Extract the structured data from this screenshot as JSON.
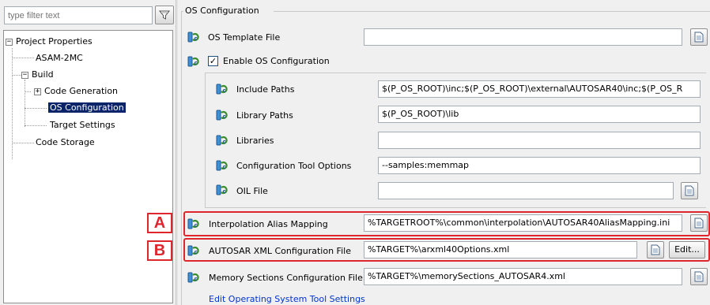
{
  "filter": {
    "placeholder": "type filter text"
  },
  "tree": {
    "root": "Project Properties",
    "items": {
      "asam": "ASAM-2MC",
      "build": "Build",
      "code_generation": "Code Generation",
      "os_configuration": "OS Configuration",
      "target_settings": "Target Settings",
      "code_storage": "Code Storage"
    },
    "selected": "OS Configuration"
  },
  "group": {
    "title": "OS Configuration"
  },
  "os_template": {
    "label": "OS Template File",
    "value": ""
  },
  "enable_os": {
    "label": "Enable OS Configuration",
    "checked": true
  },
  "include_paths": {
    "label": "Include Paths",
    "value": "$(P_OS_ROOT)\\inc;$(P_OS_ROOT)\\external\\AUTOSAR40\\inc;$(P_OS_R"
  },
  "library_paths": {
    "label": "Library Paths",
    "value": "$(P_OS_ROOT)\\lib"
  },
  "libraries": {
    "label": "Libraries",
    "value": ""
  },
  "config_tool_options": {
    "label": "Configuration Tool Options",
    "value": "--samples:memmap"
  },
  "oil_file": {
    "label": "OIL File",
    "value": ""
  },
  "interpolation": {
    "label": "Interpolation Alias Mapping",
    "value": "%TARGETROOT%\\common\\interpolation\\AUTOSAR40AliasMapping.ini"
  },
  "autosar_xml": {
    "label": "AUTOSAR XML Configuration File",
    "value": "%TARGET%\\arxml40Options.xml",
    "edit_label": "Edit..."
  },
  "memory_sections": {
    "label": "Memory Sections Configuration File",
    "value": "%TARGET%\\memorySections_AUTOSAR4.xml"
  },
  "edit_link": "Edit Operating System Tool Settings",
  "callouts": {
    "a": "A",
    "b": "B"
  },
  "colors": {
    "highlight": "#e0262d",
    "selection": "#0a246a",
    "link": "#0033cc"
  },
  "icons": {
    "row": "config-bean-icon",
    "browse": "document-icon",
    "filter": "funnel-icon"
  }
}
